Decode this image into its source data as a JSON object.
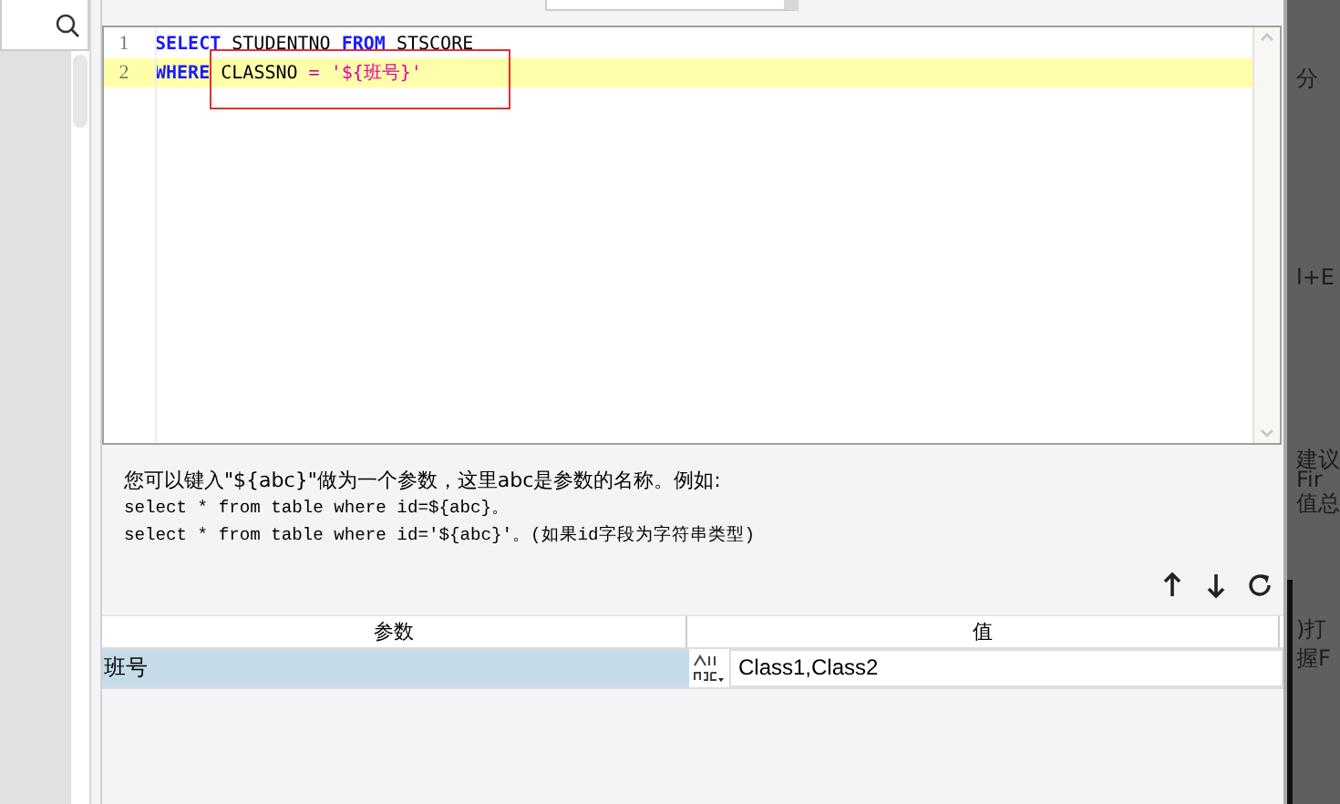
{
  "editor": {
    "lines": [
      {
        "number": "1",
        "current": false,
        "tokens": [
          {
            "kind": "keyword",
            "text": "SELECT"
          },
          {
            "kind": "plain",
            "text": " STUDENTNO "
          },
          {
            "kind": "keyword",
            "text": "FROM"
          },
          {
            "kind": "plain",
            "text": " STSCORE"
          }
        ]
      },
      {
        "number": "2",
        "current": true,
        "tokens": [
          {
            "kind": "keyword",
            "text": "WHERE"
          },
          {
            "kind": "plain",
            "text": " CLASSNO "
          },
          {
            "kind": "operator",
            "text": "="
          },
          {
            "kind": "string",
            "text": " '${班号}'"
          }
        ]
      }
    ]
  },
  "hint": [
    "您可以键入\"${abc}\"做为一个参数，这里abc是参数的名称。例如:",
    "select * from table where id=${abc}。",
    "select * from table where id='${abc}'。(如果id字段为字符串类型)"
  ],
  "table": {
    "columns": [
      "参数",
      "值"
    ],
    "rows": [
      {
        "name": "班号",
        "value": "Class1,Class2",
        "selected": true
      }
    ]
  },
  "background_texts": [
    "分",
    "l+E",
    "建议",
    "Fir",
    "值总",
    ")打",
    "握F"
  ]
}
